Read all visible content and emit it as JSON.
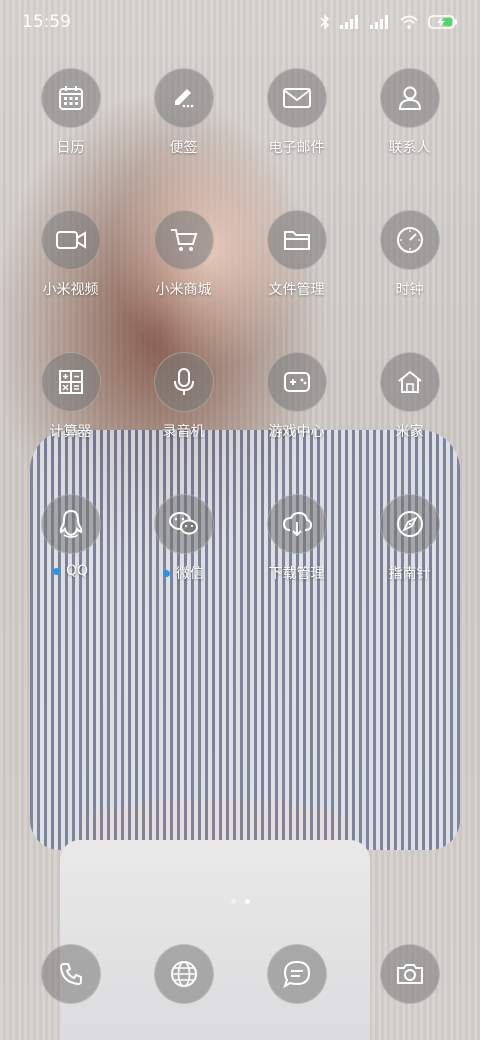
{
  "status_bar": {
    "time": "15:59",
    "icons": [
      "bluetooth-icon",
      "signal-icon",
      "signal-icon",
      "wifi-icon",
      "battery-charging-icon"
    ]
  },
  "apps": [
    {
      "label": "日历",
      "icon": "calendar-icon"
    },
    {
      "label": "便签",
      "icon": "notes-icon"
    },
    {
      "label": "电子邮件",
      "icon": "email-icon"
    },
    {
      "label": "联系人",
      "icon": "contacts-icon"
    },
    {
      "label": "小米视频",
      "icon": "video-icon"
    },
    {
      "label": "小米商城",
      "icon": "shopping-cart-icon"
    },
    {
      "label": "文件管理",
      "icon": "folder-icon"
    },
    {
      "label": "时钟",
      "icon": "clock-icon"
    },
    {
      "label": "计算器",
      "icon": "calculator-icon"
    },
    {
      "label": "录音机",
      "icon": "microphone-icon"
    },
    {
      "label": "游戏中心",
      "icon": "gamepad-icon"
    },
    {
      "label": "米家",
      "icon": "home-icon"
    },
    {
      "label": "QQ",
      "icon": "qq-penguin-icon",
      "notification_dot": true
    },
    {
      "label": "微信",
      "icon": "wechat-icon",
      "notification_dot": true
    },
    {
      "label": "下载管理",
      "icon": "cloud-download-icon"
    },
    {
      "label": "指南针",
      "icon": "compass-icon"
    }
  ],
  "pager": {
    "pages": 2,
    "active": 2
  },
  "dock": [
    {
      "icon": "phone-icon"
    },
    {
      "icon": "browser-globe-icon"
    },
    {
      "icon": "messages-icon"
    },
    {
      "icon": "camera-icon"
    }
  ],
  "colors": {
    "notification_dot": "#2196f3",
    "icon_circle": "rgba(120,120,120,0.55)"
  }
}
